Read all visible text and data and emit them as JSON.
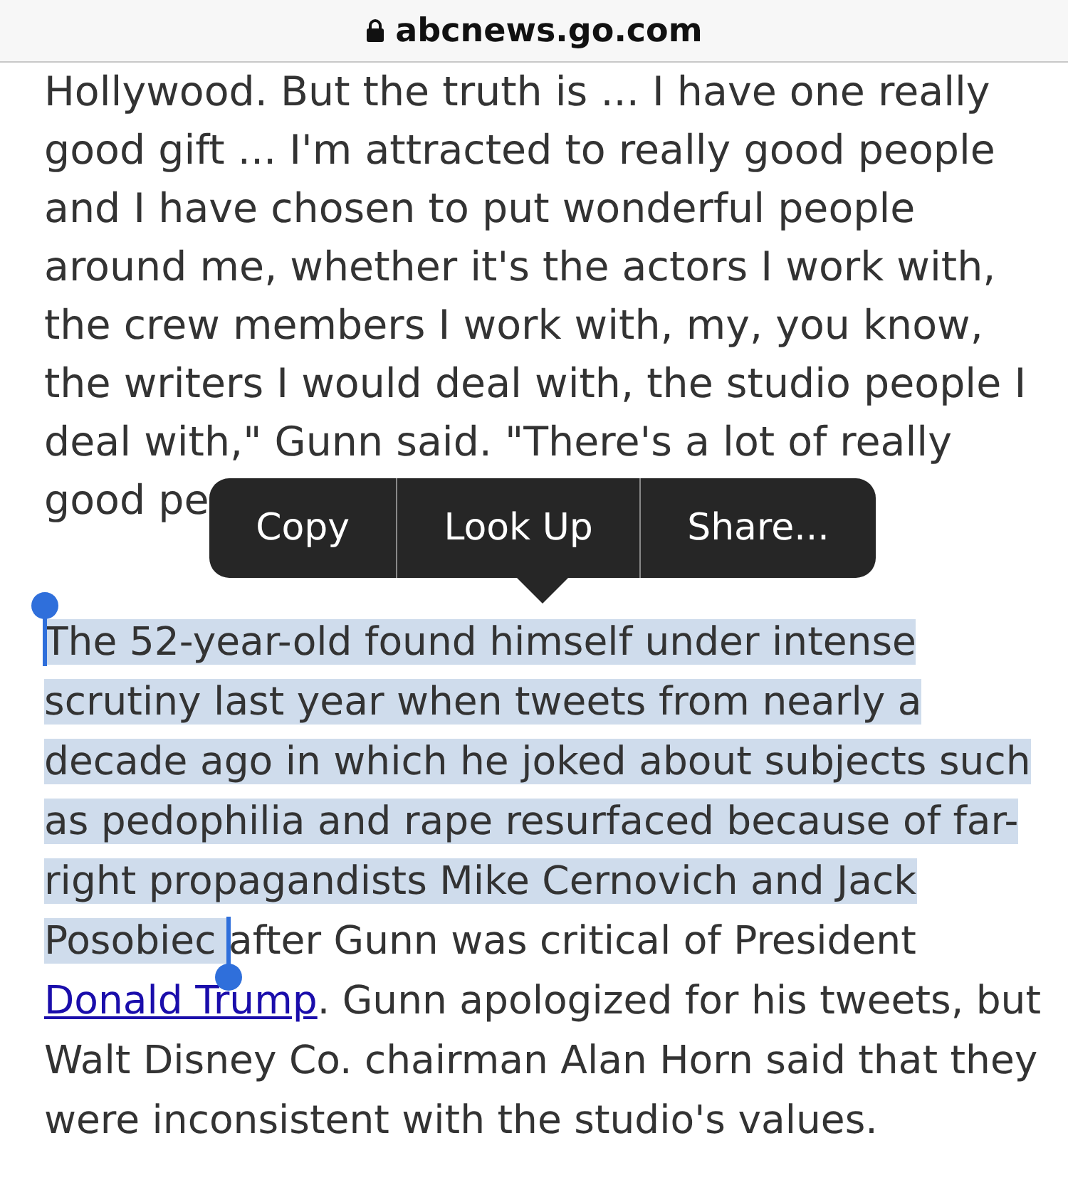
{
  "address_bar": {
    "url": "abcnews.go.com",
    "secure": true
  },
  "article": {
    "paragraph_1": [
      "Hollywood. But the truth is ... I have one really",
      "good gift ... I'm attracted to really good people",
      "and I have chosen to put wonderful people",
      "around me, whether it's the actors I work with,",
      "the crew members I work with, my, you know,",
      "the writers I would deal with, the studio people I",
      "deal with,\" Gunn said. \"There's a lot of really",
      "good pe"
    ],
    "paragraph_2": [
      {
        "kind": "text",
        "text": "The 52-year-old found himself under intense scrutiny last year when tweets from nearly a decade ago in which he joked about subjects such as pedophilia and rape resurfaced because of far-right propagandists Mike Cernovich and Jack Posobiec ",
        "selected": true
      },
      {
        "kind": "text",
        "text": "after Gunn was critical of President ",
        "selected": false
      },
      {
        "kind": "link",
        "text": "Donald Trump",
        "selected": false
      },
      {
        "kind": "text",
        "text": ". Gunn apologized for his tweets, but Walt Disney Co. chairman Alan Horn said that they were inconsistent with the studio's values.",
        "selected": false
      }
    ]
  },
  "context_menu": {
    "items": [
      "Copy",
      "Look Up",
      "Share..."
    ]
  }
}
